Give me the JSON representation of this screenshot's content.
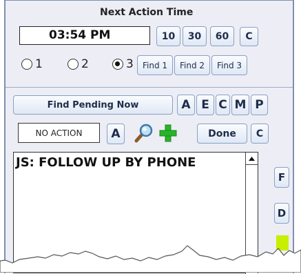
{
  "section_title": "Next Action Time",
  "time_value": "03:54 PM",
  "interval_buttons": [
    "10",
    "30",
    "60"
  ],
  "clear_time_label": "C",
  "radio_options": [
    {
      "label": "1",
      "selected": false
    },
    {
      "label": "2",
      "selected": false
    },
    {
      "label": "3",
      "selected": true
    }
  ],
  "find_buttons": [
    "Find 1",
    "Find 2",
    "Find 3"
  ],
  "find_pending_label": "Find Pending Now",
  "letter_buttons": [
    "A",
    "E",
    "C",
    "M",
    "P"
  ],
  "action_status": "NO ACTION",
  "action_a_label": "A",
  "done_label": "Done",
  "clear_action_label": "C",
  "notes_text": "JS: FOLLOW UP BY PHONE",
  "side_buttons": [
    "F",
    "D"
  ],
  "colors": {
    "panel_bg": "#ededf5",
    "border": "#7f8fb0",
    "accent_square": "#c8ee00",
    "plus_green": "#28b428"
  }
}
